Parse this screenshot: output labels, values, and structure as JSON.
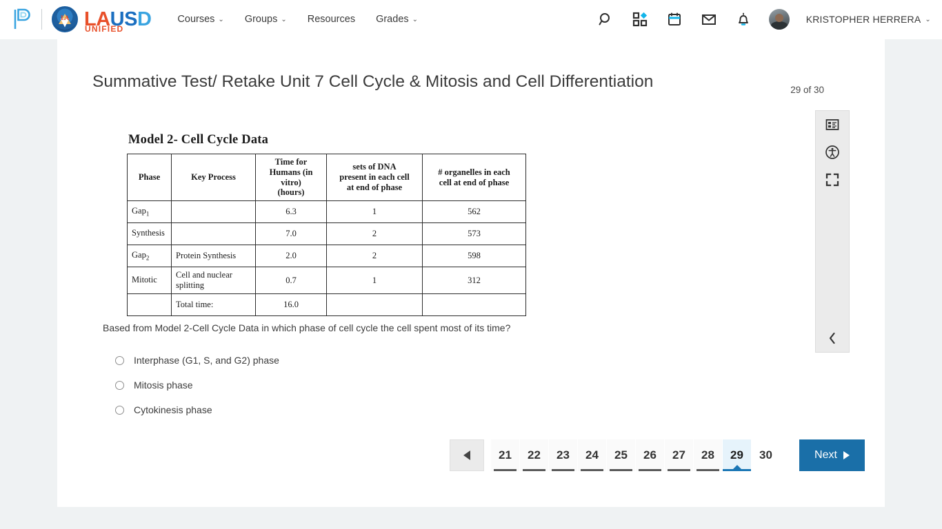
{
  "header": {
    "brand": {
      "powerschool_logo": "powerschool-p-logo",
      "district_line1_a": "LA",
      "district_line1_b": "US",
      "district_line1_c": "D",
      "district_line2": "UNIFIED",
      "seal_text": "LA"
    },
    "nav": [
      {
        "label": "Courses",
        "has_dropdown": true
      },
      {
        "label": "Groups",
        "has_dropdown": true
      },
      {
        "label": "Resources",
        "has_dropdown": false
      },
      {
        "label": "Grades",
        "has_dropdown": true
      }
    ],
    "icons": [
      {
        "name": "search-icon"
      },
      {
        "name": "apps-grid-icon"
      },
      {
        "name": "calendar-icon"
      },
      {
        "name": "mail-icon"
      },
      {
        "name": "notifications-bell-icon"
      }
    ],
    "user": {
      "name": "KRISTOPHER HERRERA",
      "caret": "⌄"
    }
  },
  "assessment": {
    "title": "Summative Test/ Retake Unit 7 Cell Cycle & Mitosis and Cell Differentiation",
    "counter": "29 of 30"
  },
  "model": {
    "title": "Model 2- Cell Cycle Data",
    "columns": [
      "Phase",
      "Key Process",
      "Time for Humans (in vitro) (hours)",
      "sets of DNA present in each cell at end of phase",
      "# organelles in each cell at end of phase"
    ],
    "column_header_lines": {
      "time": [
        "Time for",
        "Humans (in",
        "vitro)",
        "(hours)"
      ],
      "dna": [
        "sets of DNA",
        "present in each cell",
        "at end of phase"
      ],
      "organelles": [
        "# organelles in each",
        "cell at end of phase"
      ]
    },
    "rows": [
      {
        "phase": "Gap",
        "phase_sub": "1",
        "key_process": "",
        "time": "6.3",
        "dna": "1",
        "organelles": "562"
      },
      {
        "phase": "Synthesis",
        "phase_sub": "",
        "key_process": "",
        "time": "7.0",
        "dna": "2",
        "organelles": "573"
      },
      {
        "phase": "Gap",
        "phase_sub": "2",
        "key_process": "Protein Synthesis",
        "time": "2.0",
        "dna": "2",
        "organelles": "598"
      },
      {
        "phase": "Mitotic",
        "phase_sub": "",
        "key_process": "Cell and nuclear splitting",
        "time": "0.7",
        "dna": "1",
        "organelles": "312"
      },
      {
        "phase": "",
        "phase_sub": "",
        "key_process": "Total time:",
        "time": "16.0",
        "dna": "",
        "organelles": ""
      }
    ]
  },
  "question": {
    "prompt": "Based from Model 2-Cell Cycle Data in which phase of cell cycle the cell spent most of its time?",
    "options": [
      {
        "label": "Interphase (G1, S, and G2) phase",
        "selected": false
      },
      {
        "label": "Mitosis phase",
        "selected": false
      },
      {
        "label": "Cytokinesis phase",
        "selected": false
      }
    ]
  },
  "tool_rail": {
    "buttons": [
      {
        "name": "question-list-icon"
      },
      {
        "name": "accessibility-icon"
      },
      {
        "name": "fullscreen-icon"
      }
    ],
    "collapse": {
      "name": "collapse-chevron-left-icon",
      "glyph": "‹"
    }
  },
  "pagination": {
    "prev_label": "",
    "pages": [
      {
        "number": "21",
        "state": "visited"
      },
      {
        "number": "22",
        "state": "visited"
      },
      {
        "number": "23",
        "state": "visited"
      },
      {
        "number": "24",
        "state": "visited"
      },
      {
        "number": "25",
        "state": "visited"
      },
      {
        "number": "26",
        "state": "visited"
      },
      {
        "number": "27",
        "state": "visited"
      },
      {
        "number": "28",
        "state": "visited"
      },
      {
        "number": "29",
        "state": "active"
      },
      {
        "number": "30",
        "state": "plain"
      }
    ],
    "next_label": "Next"
  },
  "colors": {
    "page_bg": "#eff2f3",
    "card_bg": "#ffffff",
    "accent_blue": "#1a6fa8",
    "active_page_bg": "#e6f3fb",
    "rail_bg": "#ebebeb",
    "brand_orange": "#e8502a",
    "brand_blue": "#1b6fc0",
    "brand_lightblue": "#3aa4e0"
  }
}
